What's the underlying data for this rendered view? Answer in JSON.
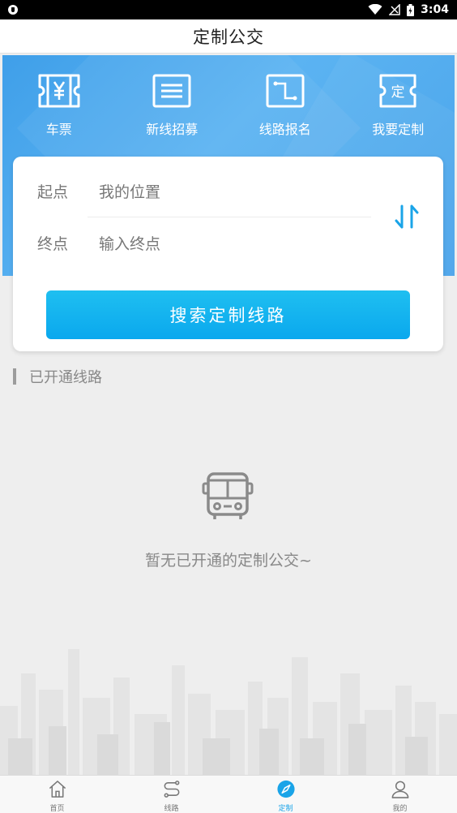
{
  "status_bar": {
    "time": "3:04",
    "icons": [
      "shield-icon",
      "wifi-icon",
      "signal-icon",
      "battery-icon"
    ]
  },
  "header": {
    "title": "定制公交"
  },
  "quick_menu": [
    {
      "label": "车票",
      "icon": "ticket-yen-icon"
    },
    {
      "label": "新线招募",
      "icon": "list-doc-icon"
    },
    {
      "label": "线路报名",
      "icon": "route-icon"
    },
    {
      "label": "我要定制",
      "icon": "custom-ticket-icon"
    }
  ],
  "search": {
    "start_label": "起点",
    "start_value": "我的位置",
    "end_label": "终点",
    "end_placeholder": "输入终点",
    "button_label": "搜索定制线路"
  },
  "section": {
    "title": "已开通线路"
  },
  "empty_state": {
    "message": "暂无已开通的定制公交~",
    "icon": "bus-icon"
  },
  "bottom_nav": [
    {
      "label": "首页",
      "icon": "home-icon",
      "active": false
    },
    {
      "label": "线路",
      "icon": "route-s-icon",
      "active": false
    },
    {
      "label": "定制",
      "icon": "compass-icon",
      "active": true
    },
    {
      "label": "我的",
      "icon": "user-icon",
      "active": false
    }
  ],
  "colors": {
    "accent": "#1aa4e8",
    "banner": "#4aa4ea",
    "button": "#12b2ef",
    "background": "#eeeeee"
  }
}
